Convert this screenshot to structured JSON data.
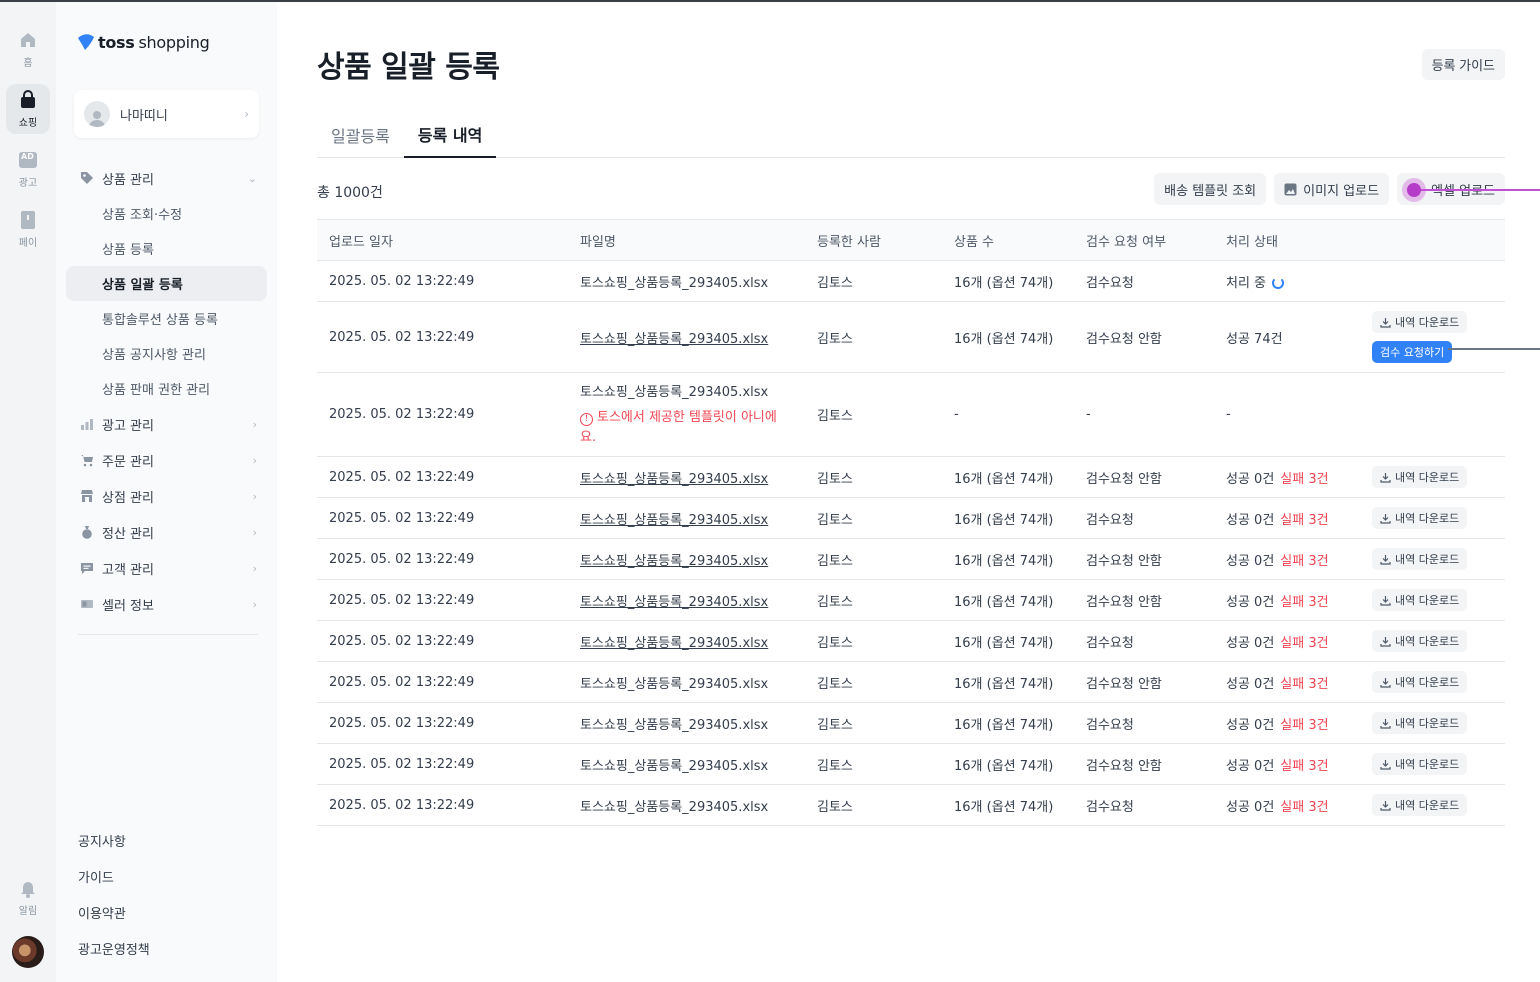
{
  "rail": {
    "home": "홈",
    "shopping": "쇼핑",
    "ads": "광고",
    "ad_badge": "AD",
    "pay": "페이",
    "alerts": "알림"
  },
  "sidebar": {
    "logo_bold": "toss",
    "logo_normal": "shopping",
    "store_name": "나마띠니",
    "groups": [
      {
        "label": "상품 관리",
        "icon": "tag-icon"
      },
      {
        "label": "광고 관리",
        "icon": "bar-chart-icon"
      },
      {
        "label": "주문 관리",
        "icon": "cart-icon"
      },
      {
        "label": "상점 관리",
        "icon": "store-icon"
      },
      {
        "label": "정산 관리",
        "icon": "money-bag-icon"
      },
      {
        "label": "고객 관리",
        "icon": "chat-icon"
      },
      {
        "label": "셀러 정보",
        "icon": "id-card-icon"
      }
    ],
    "sub_items": [
      "상품 조회·수정",
      "상품 등록",
      "상품 일괄 등록",
      "통합솔루션 상품 등록",
      "상품 공지사항 관리",
      "상품 판매 권한 관리"
    ],
    "footer": [
      "공지사항",
      "가이드",
      "이용약관",
      "광고운영정책"
    ]
  },
  "main": {
    "title": "상품 일괄 등록",
    "guide_button": "등록 가이드",
    "tabs": [
      "일괄등록",
      "등록 내역"
    ],
    "total": "총 1000건",
    "toolbar": [
      "배송 템플릿 조회",
      "이미지 업로드",
      "엑셀 업로드"
    ],
    "columns": [
      "업로드 일자",
      "파일명",
      "등록한 사람",
      "상품 수",
      "검수 요청 여부",
      "처리 상태"
    ],
    "download_label": "내역 다운로드",
    "review_button": "검수 요청하기",
    "rows": [
      {
        "date": "2025. 05. 02 13:22:49",
        "file": "토스쇼핑_상품등록_293405.xlsx",
        "who": "김토스",
        "count": "16개 (옵션 74개)",
        "review": "검수요청",
        "status": "처리 중"
      },
      {
        "date": "2025. 05. 02 13:22:49",
        "file": "토스쇼핑_상품등록_293405.xlsx",
        "who": "김토스",
        "count": "16개 (옵션 74개)",
        "review": "검수요청 안함",
        "status": "성공 74건"
      },
      {
        "date": "2025. 05. 02 13:22:49",
        "file": "토스쇼핑_상품등록_293405.xlsx",
        "error": "토스에서 제공한 템플릿이 아니에요.",
        "who": "김토스",
        "count": "-",
        "review": "-",
        "status": "-"
      },
      {
        "date": "2025. 05. 02 13:22:49",
        "file": "토스쇼핑_상품등록_293405.xlsx",
        "who": "김토스",
        "count": "16개 (옵션 74개)",
        "review": "검수요청 안함",
        "status": "성공 0건",
        "fail": "실패 3건"
      },
      {
        "date": "2025. 05. 02 13:22:49",
        "file": "토스쇼핑_상품등록_293405.xlsx",
        "who": "김토스",
        "count": "16개 (옵션 74개)",
        "review": "검수요청",
        "status": "성공 0건",
        "fail": "실패 3건"
      },
      {
        "date": "2025. 05. 02 13:22:49",
        "file": "토스쇼핑_상품등록_293405.xlsx",
        "who": "김토스",
        "count": "16개 (옵션 74개)",
        "review": "검수요청 안함",
        "status": "성공 0건",
        "fail": "실패 3건"
      },
      {
        "date": "2025. 05. 02 13:22:49",
        "file": "토스쇼핑_상품등록_293405.xlsx",
        "who": "김토스",
        "count": "16개 (옵션 74개)",
        "review": "검수요청 안함",
        "status": "성공 0건",
        "fail": "실패 3건"
      },
      {
        "date": "2025. 05. 02 13:22:49",
        "file": "토스쇼핑_상품등록_293405.xlsx",
        "who": "김토스",
        "count": "16개 (옵션 74개)",
        "review": "검수요청",
        "status": "성공 0건",
        "fail": "실패 3건"
      },
      {
        "date": "2025. 05. 02 13:22:49",
        "file": "토스쇼핑_상품등록_293405.xlsx",
        "who": "김토스",
        "count": "16개 (옵션 74개)",
        "review": "검수요청 안함",
        "status": "성공 0건",
        "fail": "실패 3건"
      },
      {
        "date": "2025. 05. 02 13:22:49",
        "file": "토스쇼핑_상품등록_293405.xlsx",
        "who": "김토스",
        "count": "16개 (옵션 74개)",
        "review": "검수요청",
        "status": "성공 0건",
        "fail": "실패 3건"
      },
      {
        "date": "2025. 05. 02 13:22:49",
        "file": "토스쇼핑_상품등록_293405.xlsx",
        "who": "김토스",
        "count": "16개 (옵션 74개)",
        "review": "검수요청 안함",
        "status": "성공 0건",
        "fail": "실패 3건"
      },
      {
        "date": "2025. 05. 02 13:22:49",
        "file": "토스쇼핑_상품등록_293405.xlsx",
        "who": "김토스",
        "count": "16개 (옵션 74개)",
        "review": "검수요청",
        "status": "성공 0건",
        "fail": "실패 3건"
      }
    ]
  },
  "colors": {
    "brand_blue": "#3182f6",
    "fail_red": "#f04452",
    "annotation_magenta": "#c24fd4"
  }
}
